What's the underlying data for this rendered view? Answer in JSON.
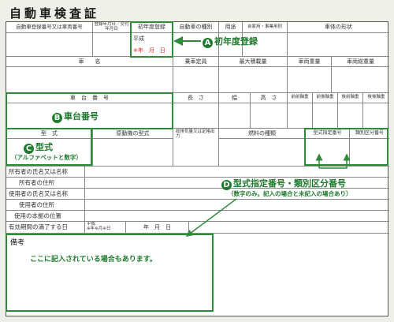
{
  "title": "自動車検査証",
  "row1": {
    "reg_no": "自動車登録番号又は車両番号",
    "reg_date": "登録年月日／交付年月日",
    "first_reg": "初年度登録",
    "first_reg_val": "平成",
    "year_month": "※年　月　日",
    "type": "自動車の種別",
    "usage": "用途",
    "private_business": "自家用・事業用別",
    "body_shape": "車体の形状"
  },
  "row2": {
    "car_name": "車　　名",
    "capacity": "乗車定員",
    "max_load": "最大積載量",
    "weight": "車両重量",
    "gross_weight": "車両総重量"
  },
  "row3": {
    "chassis_no": "車　台　番　号",
    "length": "長　さ",
    "width": "幅",
    "height": "高　さ",
    "front_front": "前前軸重",
    "front_rear": "前後軸重",
    "rear_front": "後前軸重",
    "rear_rear": "後後軸重"
  },
  "row4": {
    "model": "型　式",
    "engine_model": "原動機の型式",
    "displacement": "総排気量又は定格出力",
    "fuel": "燃料の種類",
    "model_designation": "型式指定番号",
    "category_no": "類別区分番号"
  },
  "owner": {
    "owner_name": "所有者の氏名又は名称",
    "owner_address": "所有者の住所",
    "user_name": "使用者の氏名又は名称",
    "user_address": "使用者の住所",
    "base_location": "使用の本拠の位置",
    "expiry": "有効期間の満了する日",
    "expiry_val": "平成\n※年※月※日",
    "expiry_date": "年　月　日"
  },
  "remarks": {
    "label": "備考",
    "note": "ここに記入されている場合もあります。"
  },
  "annotations": {
    "a": {
      "letter": "A",
      "text": "初年度登録"
    },
    "b": {
      "letter": "B",
      "text": "車台番号"
    },
    "c": {
      "letter": "C",
      "text": "型式",
      "sub": "（アルファベットと数字）"
    },
    "d": {
      "letter": "D",
      "text": "型式指定番号・類別区分番号",
      "sub": "（数字のみ。記入の場合と未記入の場合あり）"
    }
  },
  "colors": {
    "accent": "#2e8b3a",
    "accent_text": "#1e7a2c",
    "highlight_red": "#dd3333"
  }
}
